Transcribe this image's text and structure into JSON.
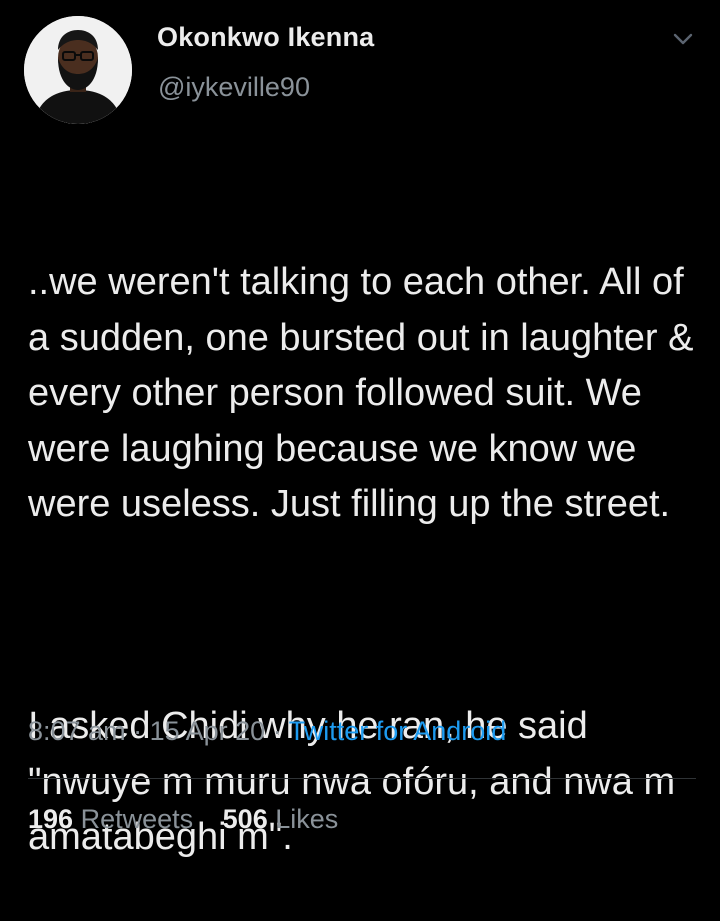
{
  "tweet": {
    "author": {
      "name": "Okonkwo Ikenna",
      "handle": "@iykeville90"
    },
    "paragraphs": [
      "..we weren't talking to each other. All of a sudden, one bursted out in laughter & every other person followed suit. We were laughing because we know we were useless. Just filling up the street.",
      "I asked Chidi why he ran, he said \"nwuye m muru nwa ofóru, and nwa m amatabeghi m\"."
    ],
    "time": "8:07 am",
    "separator": "·",
    "date": "15 Apr 20",
    "source": "Twitter for Android",
    "retweets": {
      "count": "196",
      "label": "Retweets"
    },
    "likes": {
      "count": "506",
      "label": "Likes"
    }
  },
  "icons": {
    "menu": "chevron-down-icon",
    "avatar": "avatar-illustration"
  },
  "colors": {
    "background": "#000000",
    "text": "#ececec",
    "secondary": "#8a9299",
    "link": "#1d9bf0",
    "divider": "#2f3336"
  }
}
